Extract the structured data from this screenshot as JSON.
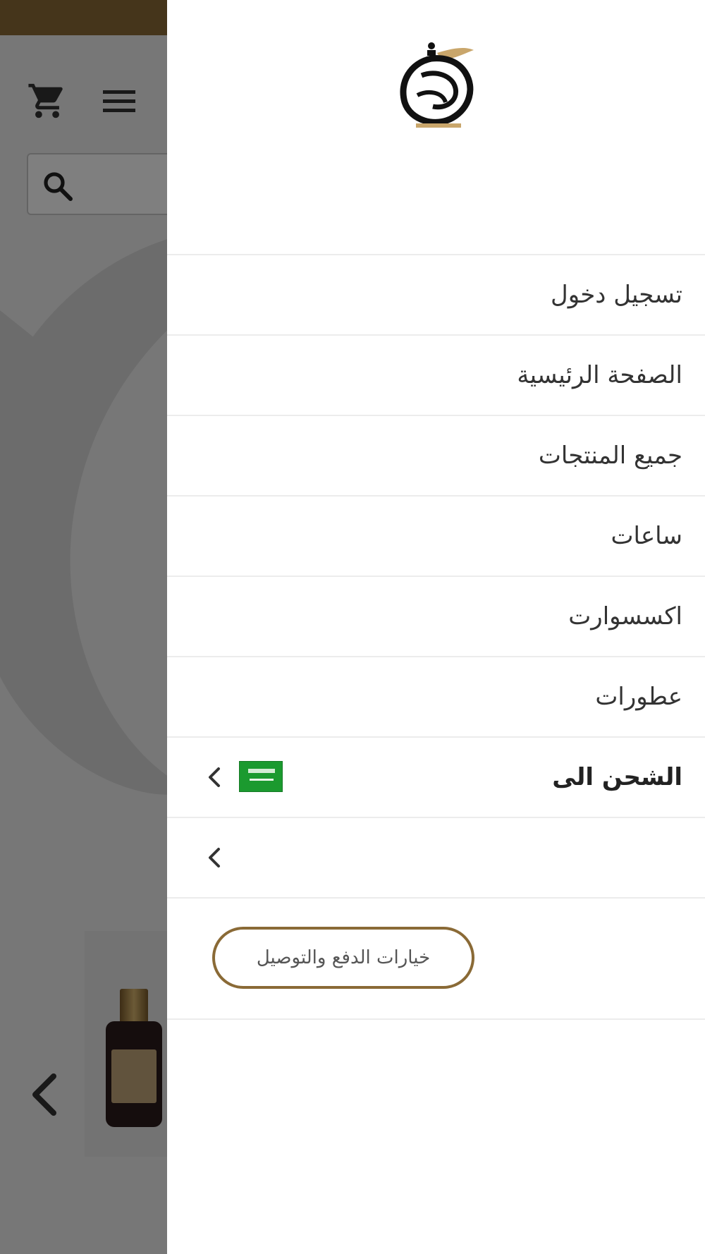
{
  "colors": {
    "brand_gold": "#8a6a36",
    "overlay": "rgba(0,0,0,0.5)",
    "divider": "#ececec",
    "flag_green": "#1b9a2f"
  },
  "background_page": {
    "icons": [
      "cart-icon",
      "menu-icon",
      "search-icon",
      "chevron-left-icon"
    ]
  },
  "drawer": {
    "logo_icon": "perfume-bottle-logo",
    "menu_items": [
      {
        "label": "تسجيل دخول"
      },
      {
        "label": "الصفحة الرئيسية"
      },
      {
        "label": "جميع المنتجات"
      },
      {
        "label": "ساعات"
      },
      {
        "label": "اكسسوارت"
      },
      {
        "label": "عطورات"
      }
    ],
    "shipping": {
      "label": "الشحن الى",
      "flag_icon": "saudi-flag-icon"
    },
    "payment_button_label": "خيارات الدفع والتوصيل"
  }
}
